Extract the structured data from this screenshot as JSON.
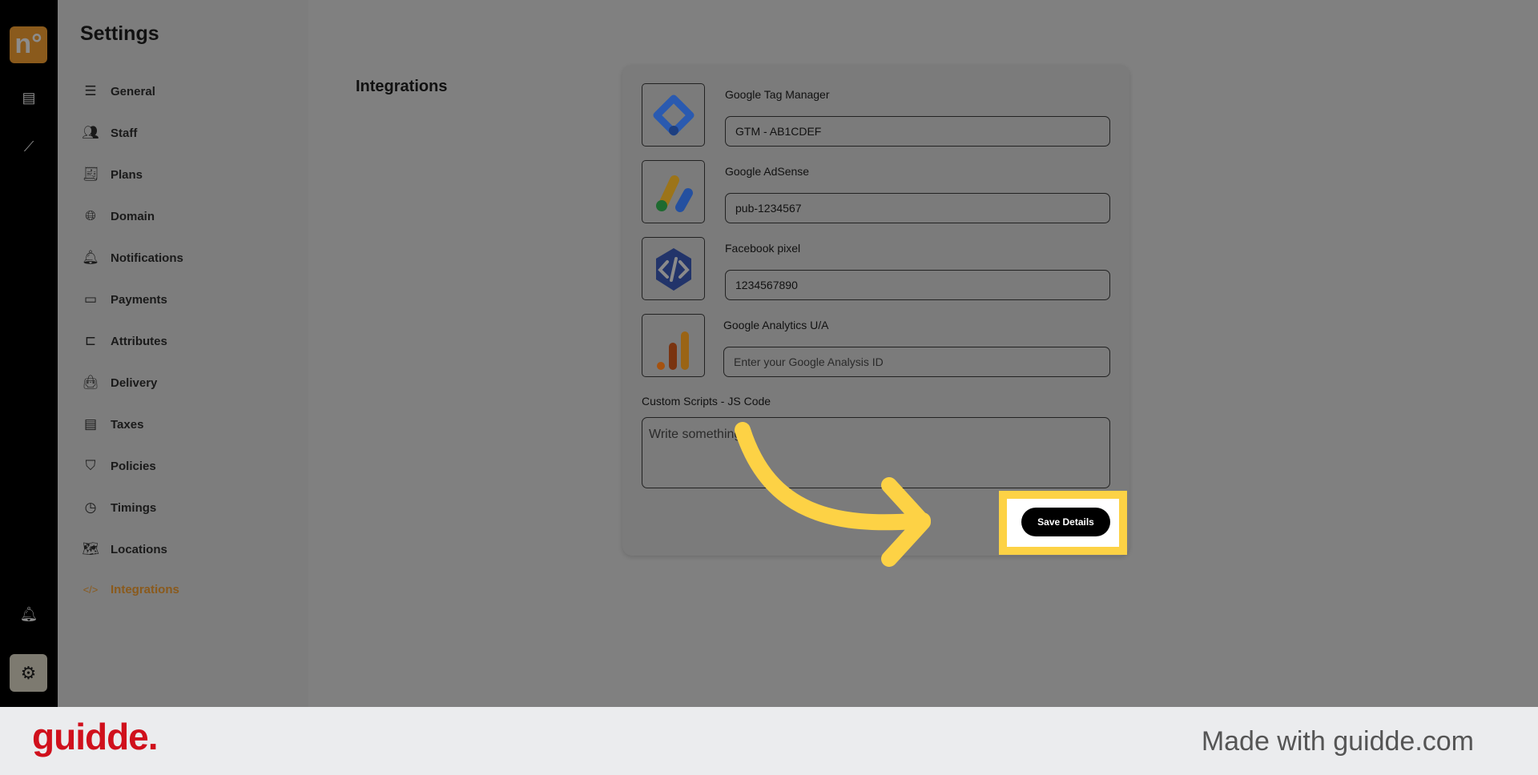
{
  "rail": {
    "logo": "n°",
    "icons": [
      "store-icon",
      "chart-icon",
      "bell-icon",
      "gear-icon"
    ]
  },
  "settings": {
    "title": "Settings",
    "items": [
      {
        "label": "General",
        "icon": "sliders-icon"
      },
      {
        "label": "Staff",
        "icon": "users-icon"
      },
      {
        "label": "Plans",
        "icon": "receipt-icon"
      },
      {
        "label": "Domain",
        "icon": "globe-icon"
      },
      {
        "label": "Notifications",
        "icon": "bell-icon"
      },
      {
        "label": "Payments",
        "icon": "wallet-icon"
      },
      {
        "label": "Attributes",
        "icon": "hierarchy-icon"
      },
      {
        "label": "Delivery",
        "icon": "bag-icon"
      },
      {
        "label": "Taxes",
        "icon": "tax-icon"
      },
      {
        "label": "Policies",
        "icon": "shield-icon"
      },
      {
        "label": "Timings",
        "icon": "clock-icon"
      },
      {
        "label": "Locations",
        "icon": "map-icon"
      },
      {
        "label": "Integrations",
        "icon": "code-icon",
        "active": true
      }
    ],
    "accent": "#8a5a1c"
  },
  "main": {
    "heading": "Integrations",
    "integrations": [
      {
        "label": "Google Tag Manager",
        "value": "GTM - AB1CDEF",
        "placeholder": ""
      },
      {
        "label": "Google AdSense",
        "value": "pub-1234567",
        "placeholder": ""
      },
      {
        "label": "Facebook pixel",
        "value": "1234567890",
        "placeholder": ""
      },
      {
        "label": "Google Analytics U/A",
        "value": "",
        "placeholder": "Enter your Google Analysis ID"
      }
    ],
    "custom_scripts": {
      "label": "Custom Scripts - JS Code",
      "placeholder": "Write something..."
    },
    "save_label": "Save Details"
  },
  "footer": {
    "logo": "guidde.",
    "tagline": "Made with guidde.com"
  },
  "colors": {
    "highlight": "#fdd245",
    "brand": "#d0101c"
  }
}
